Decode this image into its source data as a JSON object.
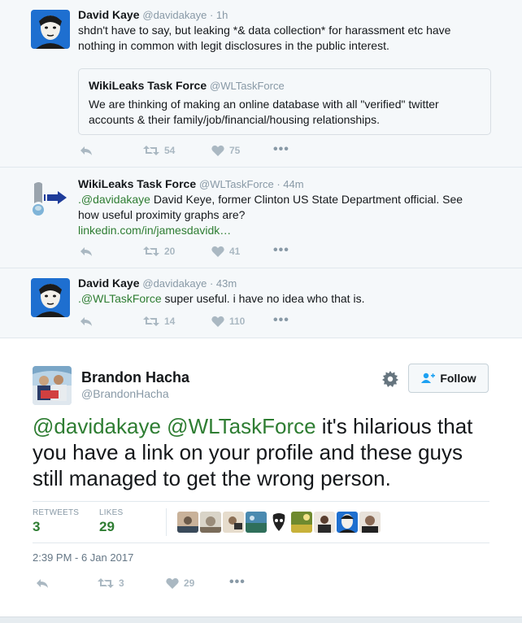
{
  "tweets": [
    {
      "name": "David Kaye",
      "handle": "@davidakaye · 1h",
      "text": "shdn't have to say, but leaking *& data collection* for harassment etc have nothing in common with legit disclosures in the public interest.",
      "quote": {
        "name": "WikiLeaks Task Force",
        "handle": "@WLTaskForce",
        "text": "We are thinking of making an online database with all \"verified\" twitter accounts & their family/job/financial/housing relationships."
      },
      "retweets": "54",
      "likes": "75"
    },
    {
      "name": "WikiLeaks Task Force",
      "handle": "@WLTaskForce · 44m",
      "mention": ".@davidakaye",
      "text": " David Keye, former Clinton US State Department official.  See how useful proximity graphs are?",
      "link": "linkedin.com/in/jamesdavidk…",
      "retweets": "20",
      "likes": "41"
    },
    {
      "name": "David Kaye",
      "handle": "@davidakaye · 43m",
      "mention": ".@WLTaskForce",
      "text": " super useful. i have no idea who that is.",
      "retweets": "14",
      "likes": "110"
    }
  ],
  "main": {
    "name": "Brandon Hacha",
    "handle": "@BrandonHacha",
    "follow_label": "Follow",
    "mention1": "@davidakaye",
    "mention2": "@WLTaskForce",
    "text": " it's hilarious that you have a link on your profile and these guys still managed to get the wrong person.",
    "retweets_label": "RETWEETS",
    "retweets": "3",
    "likes_label": "LIKES",
    "likes": "29",
    "timestamp": "2:39 PM - 6 Jan 2017",
    "action_retweets": "3",
    "action_likes": "29"
  },
  "colors": {
    "link": "#2e7d32",
    "muted": "#8899a6",
    "background": "#f5f8fa"
  },
  "icons": [
    "reply-icon",
    "retweet-icon",
    "like-icon",
    "more-icon",
    "gear-icon",
    "follow-user-icon"
  ]
}
